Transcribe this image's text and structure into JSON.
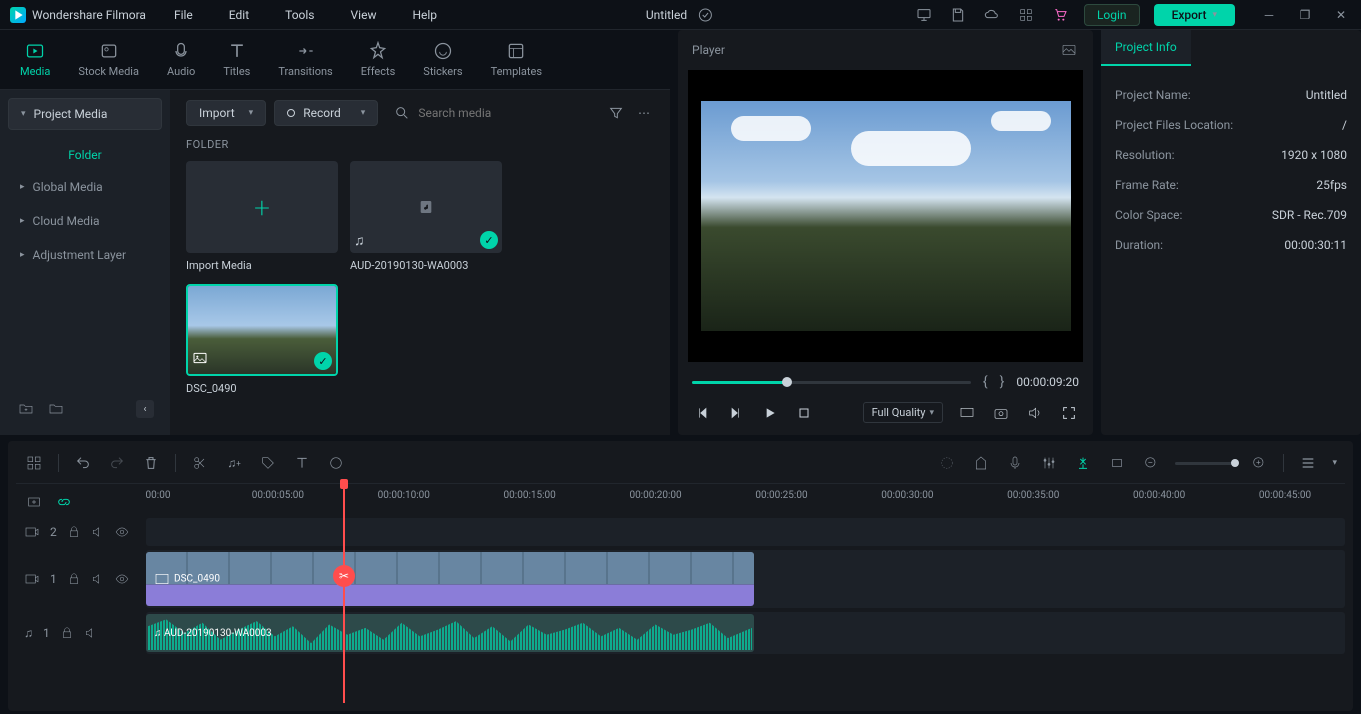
{
  "app": {
    "name": "Wondershare Filmora"
  },
  "menubar": [
    "File",
    "Edit",
    "Tools",
    "View",
    "Help"
  ],
  "title": "Untitled",
  "header": {
    "login": "Login",
    "export": "Export"
  },
  "tabs": [
    "Media",
    "Stock Media",
    "Audio",
    "Titles",
    "Transitions",
    "Effects",
    "Stickers",
    "Templates"
  ],
  "sidebar": {
    "project_media": "Project Media",
    "folder": "Folder",
    "items": [
      "Global Media",
      "Cloud Media",
      "Adjustment Layer"
    ]
  },
  "toolbar": {
    "import": "Import",
    "record": "Record",
    "search_placeholder": "Search media"
  },
  "media": {
    "folder_header": "FOLDER",
    "tiles": [
      {
        "label": "Import Media",
        "type": "add"
      },
      {
        "label": "AUD-20190130-WA0003",
        "type": "audio"
      },
      {
        "label": "DSC_0490",
        "type": "image"
      }
    ]
  },
  "player": {
    "header": "Player",
    "timecode": "00:00:09:20",
    "quality": "Full Quality"
  },
  "info": {
    "tab": "Project Info",
    "rows": [
      {
        "label": "Project Name:",
        "value": "Untitled"
      },
      {
        "label": "Project Files Location:",
        "value": "/"
      },
      {
        "label": "Resolution:",
        "value": "1920 x 1080"
      },
      {
        "label": "Frame Rate:",
        "value": "25fps"
      },
      {
        "label": "Color Space:",
        "value": "SDR - Rec.709"
      },
      {
        "label": "Duration:",
        "value": "00:00:30:11"
      }
    ]
  },
  "timeline": {
    "ruler": [
      "00:00",
      "00:00:05:00",
      "00:00:10:00",
      "00:00:15:00",
      "00:00:20:00",
      "00:00:25:00",
      "00:00:30:00",
      "00:00:35:00",
      "00:00:40:00",
      "00:00:45:00"
    ],
    "tracks": {
      "video2": "2",
      "video1": "1",
      "audio1": "1"
    },
    "clips": {
      "video": "DSC_0490",
      "audio": "AUD-20190130-WA0003"
    }
  }
}
